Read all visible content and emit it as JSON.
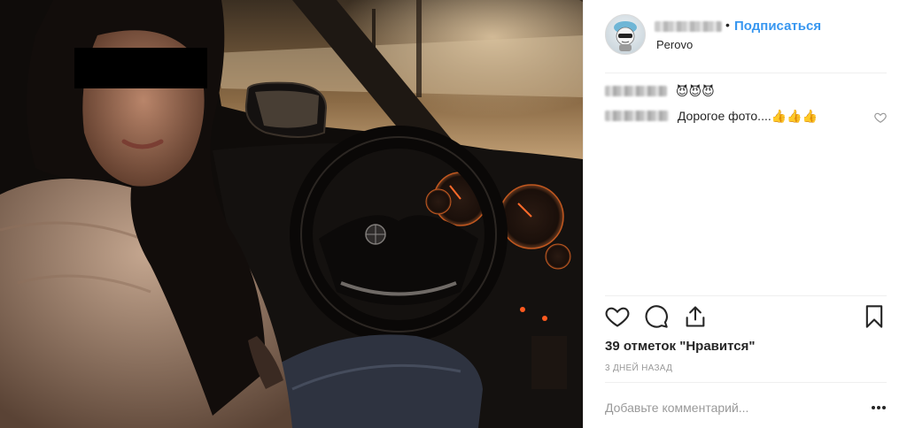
{
  "post": {
    "location": "Perovo",
    "follow_label": "Подписаться",
    "separator": "•",
    "avatar_icon": "cartoon-avatar-icon"
  },
  "comments": [
    {
      "author_hidden": true,
      "text": "😈😈😈"
    },
    {
      "author_hidden": true,
      "text": "Дорогое фото....👍👍👍"
    }
  ],
  "actions": {
    "like_icon": "heart-icon",
    "comment_icon": "comment-icon",
    "share_icon": "share-icon",
    "save_icon": "bookmark-icon"
  },
  "likes_text": "39 отметок \"Нравится\"",
  "time_text": "3 ДНЕЙ НАЗАД",
  "comment_input": {
    "placeholder": "Добавьте комментарий...",
    "value": ""
  },
  "more_icon": "more-options-icon",
  "colors": {
    "accent": "#3897f0",
    "text": "#262626",
    "muted": "#999999"
  }
}
